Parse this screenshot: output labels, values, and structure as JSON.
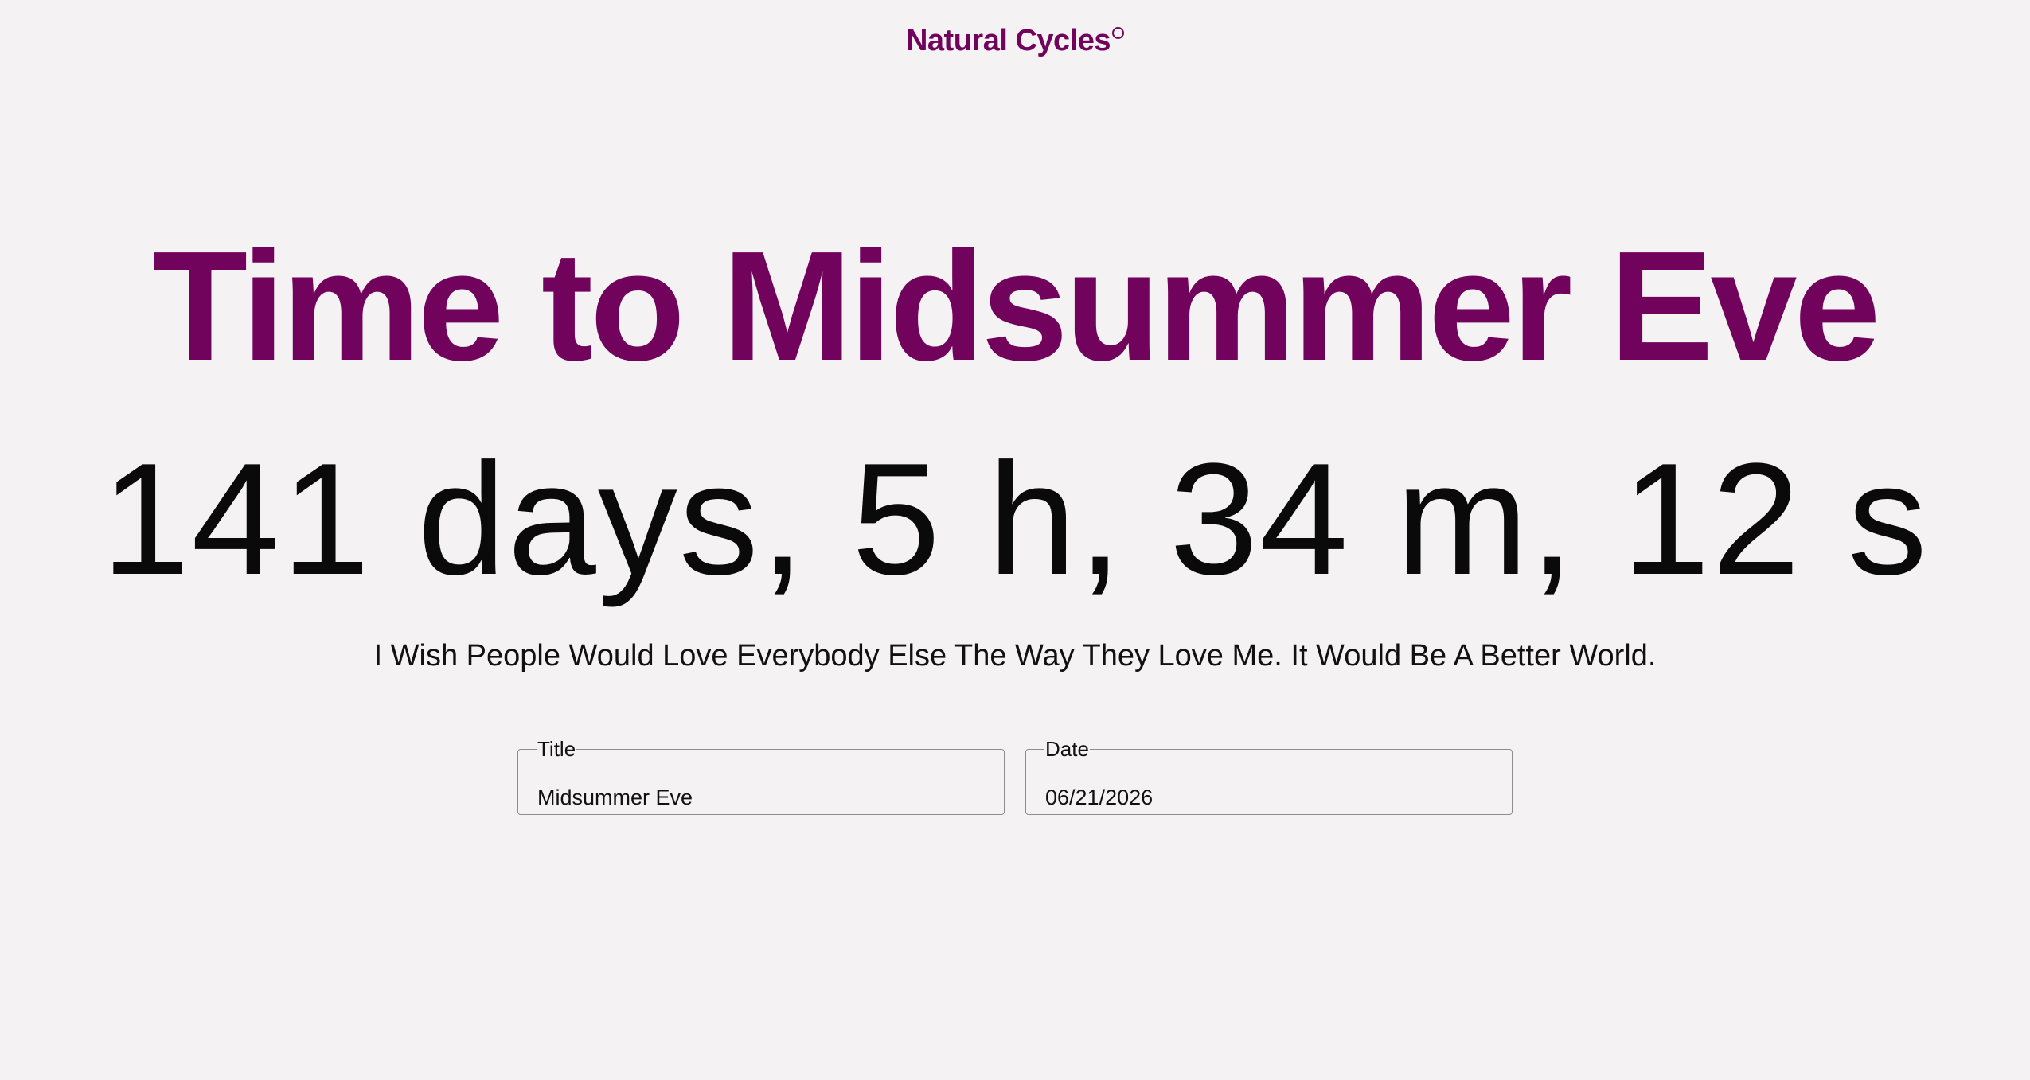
{
  "brand": {
    "name": "Natural Cycles",
    "color": "#72035d"
  },
  "headline": "Time to Midsummer Eve",
  "countdown": "141 days, 5 h, 34 m, 12 s",
  "quote": "I Wish People Would Love Everybody Else The Way They Love Me. It Would Be A Better World.",
  "form": {
    "title": {
      "label": "Title",
      "value": "Midsummer Eve"
    },
    "date": {
      "label": "Date",
      "value": "06/21/2026"
    }
  },
  "colors": {
    "background": "#f4f2f3",
    "text": "#0a0a0a",
    "field_border": "#8e8c8d"
  }
}
